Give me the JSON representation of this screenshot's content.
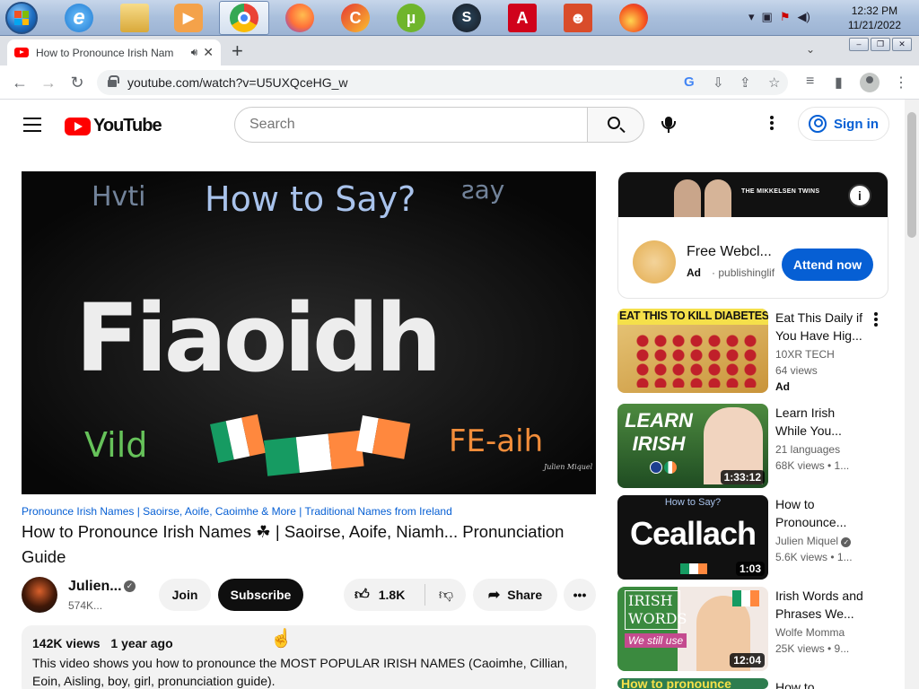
{
  "taskbar": {
    "pinned": [
      {
        "name": "ie-icon",
        "glyph": "e",
        "color": "#2a8bd9"
      },
      {
        "name": "file-explorer-icon",
        "glyph": "",
        "color": "#e9c566"
      },
      {
        "name": "media-player-icon",
        "glyph": "▶",
        "color": "#e07b2c"
      },
      {
        "name": "chrome-icon",
        "glyph": "",
        "color": "#34a853"
      },
      {
        "name": "firefox-icon",
        "glyph": "",
        "color": "#ff7139"
      },
      {
        "name": "ccleaner-icon",
        "glyph": "C",
        "color": "#d33"
      },
      {
        "name": "utorrent-icon",
        "glyph": "µ",
        "color": "#6fb52c"
      },
      {
        "name": "steam-icon",
        "glyph": "S",
        "color": "#1b2838"
      },
      {
        "name": "acrobat-icon",
        "glyph": "A",
        "color": "#d00"
      },
      {
        "name": "paint-app-icon",
        "glyph": "☻",
        "color": "#d94c2a"
      },
      {
        "name": "firefox-alt-icon",
        "glyph": "",
        "color": "#e86a2b"
      }
    ],
    "clock_time": "12:32 PM",
    "clock_date": "11/21/2022"
  },
  "browser": {
    "tab_title": "How to Pronounce Irish Nam",
    "url": "youtube.com/watch?v=U5UXQceHG_w"
  },
  "youtube": {
    "logo_text": "YouTube",
    "search_placeholder": "Search",
    "sign_in": "Sign in"
  },
  "player": {
    "thumb_top_left": "Hvti",
    "thumb_heading": "How to Say?",
    "thumb_top_right": "ƨay",
    "thumb_word": "Fiaoidh",
    "thumb_bottom_left": "Vild",
    "thumb_bottom_right": "FE-aih",
    "thumb_watermark": "Julien Miquel"
  },
  "video": {
    "hashtags": "Pronounce Irish Names | Saoirse, Aoife, Caoimhe & More | Traditional Names from Ireland",
    "title": "How to Pronounce Irish Names ☘ | Saoirse, Aoife, Niamh... Pronunciation Guide",
    "channel_name": "Julien...",
    "subscribers": "574K...",
    "join_label": "Join",
    "subscribe_label": "Subscribe",
    "likes": "1.8K",
    "share_label": "Share",
    "views": "142K views",
    "age": "1 year ago",
    "description": "This video shows you how to pronounce the MOST POPULAR IRISH NAMES (Caoimhe, Cillian, Eoin, Aisling, boy, girl, pronunciation guide)."
  },
  "ad": {
    "banner_text": "THE MIKKELSEN TWINS",
    "title": "Free Webcl...",
    "badge": "Ad",
    "advertiser": "publishinglif",
    "cta": "Attend now"
  },
  "recommendations": [
    {
      "title": "Eat This Daily if You Have Hig...",
      "channel": "10XR TECH",
      "views": "64 views",
      "ad": "Ad",
      "duration": "",
      "thumb_text": "EAT THIS TO KILL DIABETES"
    },
    {
      "title": "Learn Irish While You...",
      "channel": "21 languages",
      "views": "68K views • 1...",
      "ad": "",
      "duration": "1:33:12",
      "thumb_text": "LEARN IRISH"
    },
    {
      "title": "How to Pronounce...",
      "channel": "Julien Miquel",
      "views": "5.6K views • 1...",
      "ad": "",
      "duration": "1:03",
      "thumb_text": "Ceallach",
      "thumb_sub": "How to Say?"
    },
    {
      "title": "Irish Words and Phrases We...",
      "channel": "Wolfe Momma",
      "views": "25K views • 9...",
      "ad": "",
      "duration": "12:04",
      "thumb_text": "IRISH WORDS",
      "thumb_sub": "We still use"
    },
    {
      "title": "How to",
      "channel": "",
      "views": "",
      "ad": "",
      "duration": "",
      "thumb_text": "How to pronounce"
    }
  ]
}
